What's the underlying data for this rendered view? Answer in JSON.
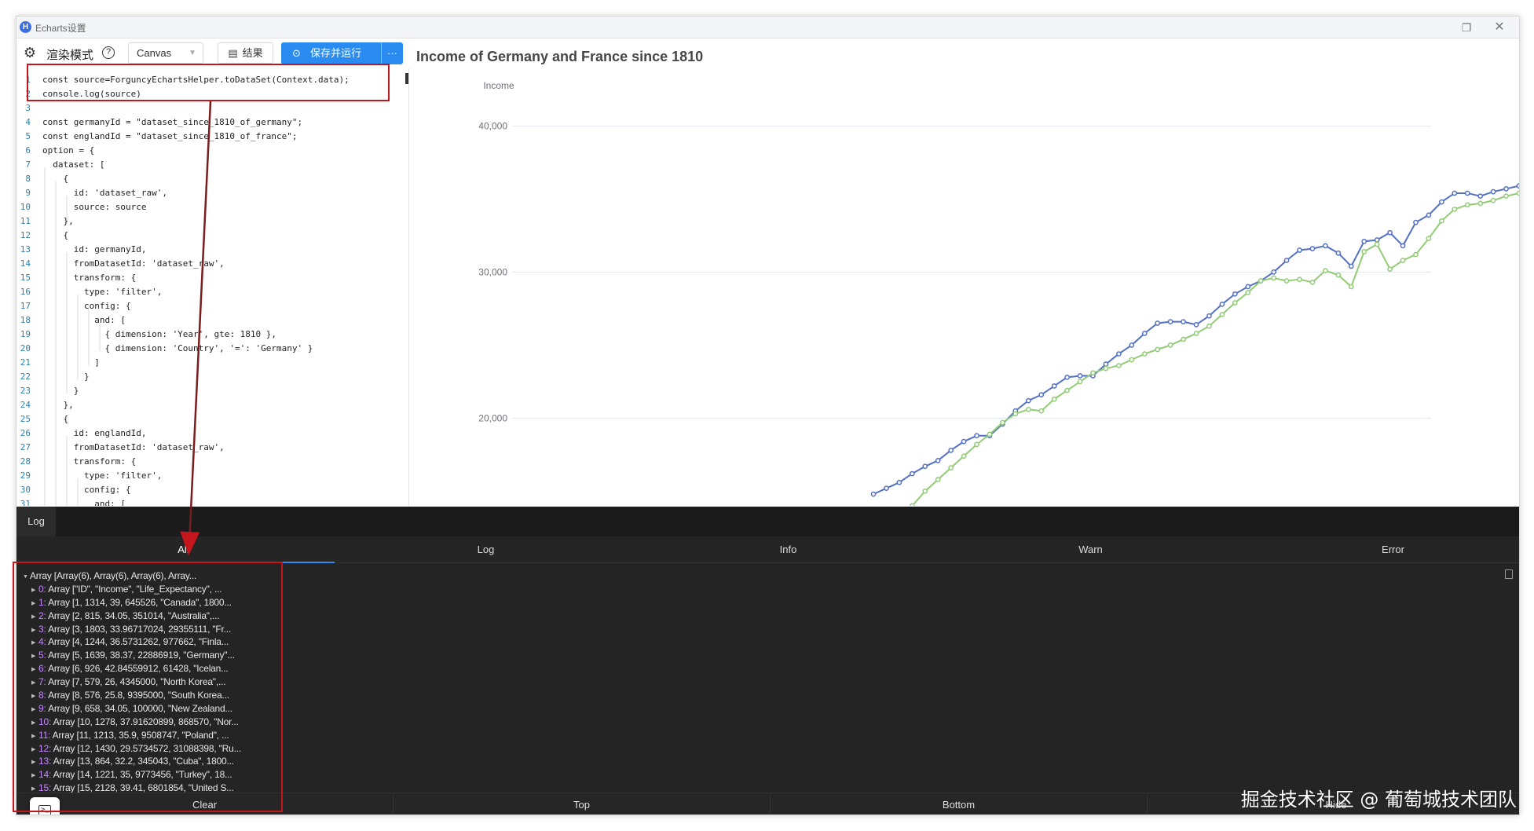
{
  "window": {
    "title": "Echarts设置",
    "app_icon": "H",
    "restore_icon": "❐",
    "close_icon": "✕"
  },
  "toolbar": {
    "settings_icon": "gear-icon",
    "render_mode_label": "渲染模式",
    "help_icon": "?",
    "render_select_value": "Canvas",
    "result_label": "结果",
    "run_label": "保存并运行",
    "more_label": "···"
  },
  "editor": {
    "lines": [
      {
        "n": "1",
        "text": "const source=ForguncyEchartsHelper.toDataSet(Context.data);"
      },
      {
        "n": "2",
        "text": "console.log(source)"
      },
      {
        "n": "3",
        "text": ""
      },
      {
        "n": "4",
        "text": "const germanyId = \"dataset_since_1810_of_germany\";"
      },
      {
        "n": "5",
        "text": "const englandId = \"dataset_since_1810_of_france\";"
      },
      {
        "n": "6",
        "text": "option = {"
      },
      {
        "n": "7",
        "text": "  dataset: ["
      },
      {
        "n": "8",
        "text": "    {"
      },
      {
        "n": "9",
        "text": "      id: 'dataset_raw',"
      },
      {
        "n": "10",
        "text": "      source: source"
      },
      {
        "n": "11",
        "text": "    },"
      },
      {
        "n": "12",
        "text": "    {"
      },
      {
        "n": "13",
        "text": "      id: germanyId,"
      },
      {
        "n": "14",
        "text": "      fromDatasetId: 'dataset_raw',"
      },
      {
        "n": "15",
        "text": "      transform: {"
      },
      {
        "n": "16",
        "text": "        type: 'filter',"
      },
      {
        "n": "17",
        "text": "        config: {"
      },
      {
        "n": "18",
        "text": "          and: ["
      },
      {
        "n": "19",
        "text": "            { dimension: 'Year', gte: 1810 },"
      },
      {
        "n": "20",
        "text": "            { dimension: 'Country', '=': 'Germany' }"
      },
      {
        "n": "21",
        "text": "          ]"
      },
      {
        "n": "22",
        "text": "        }"
      },
      {
        "n": "23",
        "text": "      }"
      },
      {
        "n": "24",
        "text": "    },"
      },
      {
        "n": "25",
        "text": "    {"
      },
      {
        "n": "26",
        "text": "      id: englandId,"
      },
      {
        "n": "27",
        "text": "      fromDatasetId: 'dataset_raw',"
      },
      {
        "n": "28",
        "text": "      transform: {"
      },
      {
        "n": "29",
        "text": "        type: 'filter',"
      },
      {
        "n": "30",
        "text": "        config: {"
      },
      {
        "n": "31",
        "text": "          and: ["
      }
    ]
  },
  "chart_data": {
    "type": "line",
    "title": "Income of Germany and France since 1810",
    "ylabel": "Income",
    "ylim": [
      14000,
      44000
    ],
    "ytick_labels": [
      "20,000",
      "30,000",
      "40,000"
    ],
    "yticks": [
      20000,
      30000,
      40000
    ],
    "grid": true,
    "colors": [
      "#5470c6",
      "#91cc75"
    ],
    "series": [
      {
        "color": "#5470c6",
        "points": [
          [
            0.0,
            14800
          ],
          [
            0.02,
            15200
          ],
          [
            0.04,
            15600
          ],
          [
            0.06,
            16200
          ],
          [
            0.08,
            16700
          ],
          [
            0.1,
            17100
          ],
          [
            0.12,
            17800
          ],
          [
            0.14,
            18400
          ],
          [
            0.16,
            18800
          ],
          [
            0.18,
            18800
          ],
          [
            0.2,
            19600
          ],
          [
            0.22,
            20500
          ],
          [
            0.24,
            21200
          ],
          [
            0.26,
            21600
          ],
          [
            0.28,
            22200
          ],
          [
            0.3,
            22800
          ],
          [
            0.32,
            22900
          ],
          [
            0.34,
            22900
          ],
          [
            0.36,
            23700
          ],
          [
            0.38,
            24400
          ],
          [
            0.4,
            25000
          ],
          [
            0.42,
            25800
          ],
          [
            0.44,
            26500
          ],
          [
            0.46,
            26600
          ],
          [
            0.48,
            26600
          ],
          [
            0.5,
            26400
          ],
          [
            0.52,
            27000
          ],
          [
            0.54,
            27800
          ],
          [
            0.56,
            28500
          ],
          [
            0.58,
            29000
          ],
          [
            0.6,
            29400
          ],
          [
            0.62,
            30000
          ],
          [
            0.64,
            30800
          ],
          [
            0.66,
            31500
          ],
          [
            0.68,
            31600
          ],
          [
            0.7,
            31800
          ],
          [
            0.72,
            31300
          ],
          [
            0.74,
            30400
          ],
          [
            0.76,
            32100
          ],
          [
            0.78,
            32200
          ],
          [
            0.8,
            32700
          ],
          [
            0.82,
            31800
          ],
          [
            0.84,
            33400
          ],
          [
            0.86,
            33900
          ],
          [
            0.88,
            34800
          ],
          [
            0.9,
            35400
          ],
          [
            0.92,
            35400
          ],
          [
            0.94,
            35200
          ],
          [
            0.96,
            35500
          ],
          [
            0.98,
            35700
          ],
          [
            1.0,
            35900
          ]
        ]
      },
      {
        "color": "#91cc75",
        "points": [
          [
            0.06,
            14000
          ],
          [
            0.08,
            15000
          ],
          [
            0.1,
            15800
          ],
          [
            0.12,
            16600
          ],
          [
            0.14,
            17400
          ],
          [
            0.16,
            18200
          ],
          [
            0.18,
            18900
          ],
          [
            0.2,
            19700
          ],
          [
            0.22,
            20300
          ],
          [
            0.24,
            20600
          ],
          [
            0.26,
            20500
          ],
          [
            0.28,
            21300
          ],
          [
            0.3,
            21900
          ],
          [
            0.32,
            22500
          ],
          [
            0.34,
            23100
          ],
          [
            0.36,
            23400
          ],
          [
            0.38,
            23600
          ],
          [
            0.4,
            24000
          ],
          [
            0.42,
            24400
          ],
          [
            0.44,
            24700
          ],
          [
            0.46,
            25000
          ],
          [
            0.48,
            25400
          ],
          [
            0.5,
            25800
          ],
          [
            0.52,
            26300
          ],
          [
            0.54,
            27100
          ],
          [
            0.56,
            27900
          ],
          [
            0.58,
            28600
          ],
          [
            0.6,
            29400
          ],
          [
            0.62,
            29600
          ],
          [
            0.64,
            29400
          ],
          [
            0.66,
            29500
          ],
          [
            0.68,
            29300
          ],
          [
            0.7,
            30100
          ],
          [
            0.72,
            29800
          ],
          [
            0.74,
            29000
          ],
          [
            0.76,
            31400
          ],
          [
            0.78,
            31900
          ],
          [
            0.8,
            30200
          ],
          [
            0.82,
            30800
          ],
          [
            0.84,
            31200
          ],
          [
            0.86,
            32300
          ],
          [
            0.88,
            33500
          ],
          [
            0.9,
            34300
          ],
          [
            0.92,
            34600
          ],
          [
            0.94,
            34700
          ],
          [
            0.96,
            34900
          ],
          [
            0.98,
            35200
          ],
          [
            1.0,
            35400
          ]
        ]
      }
    ]
  },
  "console": {
    "tab_label": "Log",
    "filters": [
      "All",
      "Log",
      "Info",
      "Warn",
      "Error"
    ],
    "active_filter": "All",
    "root": "Array [Array(6), Array(6), Array(6), Array...",
    "items": [
      {
        "idx": "0:",
        "text": " Array [\"ID\", \"Income\", \"Life_Expectancy\", ..."
      },
      {
        "idx": "1:",
        "text": " Array [1, 1314, 39, 645526, \"Canada\", 1800..."
      },
      {
        "idx": "2:",
        "text": " Array [2, 815, 34.05, 351014, \"Australia\",..."
      },
      {
        "idx": "3:",
        "text": " Array [3, 1803, 33.96717024, 29355111, \"Fr..."
      },
      {
        "idx": "4:",
        "text": " Array [4, 1244, 36.5731262, 977662, \"Finla..."
      },
      {
        "idx": "5:",
        "text": " Array [5, 1639, 38.37, 22886919, \"Germany\"..."
      },
      {
        "idx": "6:",
        "text": " Array [6, 926, 42.84559912, 61428, \"Icelan..."
      },
      {
        "idx": "7:",
        "text": " Array [7, 579, 26, 4345000, \"North Korea\",..."
      },
      {
        "idx": "8:",
        "text": " Array [8, 576, 25.8, 9395000, \"South Korea..."
      },
      {
        "idx": "9:",
        "text": " Array [9, 658, 34.05, 100000, \"New Zealand..."
      },
      {
        "idx": "10:",
        "text": " Array [10, 1278, 37.91620899, 868570, \"Nor..."
      },
      {
        "idx": "11:",
        "text": " Array [11, 1213, 35.9, 9508747, \"Poland\", ..."
      },
      {
        "idx": "12:",
        "text": " Array [12, 1430, 29.5734572, 31088398, \"Ru..."
      },
      {
        "idx": "13:",
        "text": " Array [13, 864, 32.2, 345043, \"Cuba\", 1800..."
      },
      {
        "idx": "14:",
        "text": " Array [14, 1221, 35, 9773456, \"Turkey\", 18..."
      },
      {
        "idx": "15:",
        "text": " Array [15, 2128, 39.41, 6801854, \"United S..."
      }
    ],
    "footer_buttons": [
      "Clear",
      "Top",
      "Bottom",
      "Hide"
    ]
  },
  "watermark": "掘金技术社区 @ 葡萄城技术团队"
}
